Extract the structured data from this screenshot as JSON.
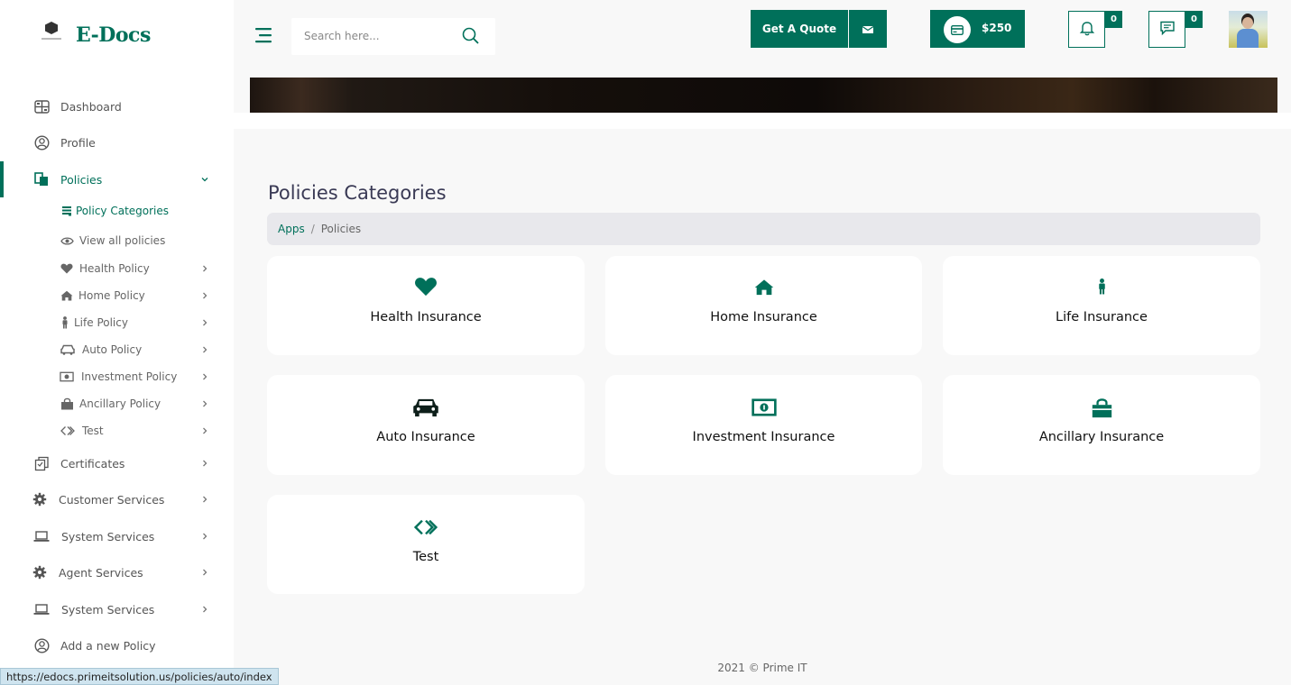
{
  "brand": {
    "name": "E-Docs"
  },
  "colors": {
    "accent": "#00705a",
    "text": "#555555",
    "title": "#3a3a55"
  },
  "header": {
    "search_placeholder": "Search here...",
    "quote_label": "Get A Quote",
    "wallet_amount": "$250",
    "notifications_count": "0",
    "messages_count": "0"
  },
  "sidebar": {
    "items": [
      {
        "label": "Dashboard",
        "icon": "dashboard-icon"
      },
      {
        "label": "Profile",
        "icon": "user-circle-icon"
      },
      {
        "label": "Policies",
        "icon": "policies-icon"
      },
      {
        "label": "Certificates",
        "icon": "certificates-icon"
      },
      {
        "label": "Customer Services",
        "icon": "gear-icon"
      },
      {
        "label": "System Services",
        "icon": "laptop-icon"
      },
      {
        "label": "Agent Services",
        "icon": "gear-icon"
      },
      {
        "label": "System Services",
        "icon": "laptop-icon"
      },
      {
        "label": "Add a new Policy",
        "icon": "user-circle-icon"
      }
    ],
    "policies_sub": [
      {
        "label": "Policy Categories",
        "icon": "list-icon"
      },
      {
        "label": "View all policies",
        "icon": "eye-icon"
      },
      {
        "label": "Health Policy",
        "icon": "heart-icon"
      },
      {
        "label": "Home Policy",
        "icon": "home-icon"
      },
      {
        "label": "Life Policy",
        "icon": "person-icon"
      },
      {
        "label": "Auto Policy",
        "icon": "car-icon"
      },
      {
        "label": "Investment Policy",
        "icon": "money-icon"
      },
      {
        "label": "Ancillary Policy",
        "icon": "bag-icon"
      },
      {
        "label": "Test",
        "icon": "code-icon"
      }
    ]
  },
  "main": {
    "title": "Policies Categories",
    "breadcrumb": {
      "link": "Apps",
      "current": "Policies"
    },
    "cards": [
      {
        "title": "Health Insurance",
        "icon": "heart-icon"
      },
      {
        "title": "Home Insurance",
        "icon": "home-icon"
      },
      {
        "title": "Life Insurance",
        "icon": "person-icon"
      },
      {
        "title": "Auto Insurance",
        "icon": "car-icon"
      },
      {
        "title": "Investment Insurance",
        "icon": "money-icon"
      },
      {
        "title": "Ancillary Insurance",
        "icon": "bag-icon"
      },
      {
        "title": "Test",
        "icon": "code-icon"
      }
    ]
  },
  "footer": {
    "text": "2021 © Prime IT"
  },
  "status_url": "https://edocs.primeitsolution.us/policies/auto/index"
}
